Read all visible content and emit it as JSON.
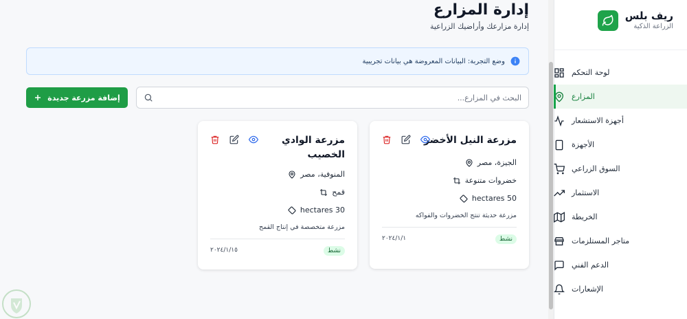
{
  "brand": {
    "title": "ريف بلس",
    "subtitle": "الزراعة الذكية"
  },
  "nav": [
    {
      "label": "لوحة التحكم",
      "icon": "dashboard-icon"
    },
    {
      "label": "المزارع",
      "icon": "map-pin-icon",
      "active": true
    },
    {
      "label": "أجهزة الاستشعار",
      "icon": "activity-icon"
    },
    {
      "label": "الأجهزة",
      "icon": "device-icon"
    },
    {
      "label": "السوق الزراعي",
      "icon": "cart-icon"
    },
    {
      "label": "الاستثمار",
      "icon": "trending-up-icon"
    },
    {
      "label": "الخريطة",
      "icon": "map-icon"
    },
    {
      "label": "متاجر المستلزمات",
      "icon": "store-icon"
    },
    {
      "label": "الدعم الفني",
      "icon": "chat-icon"
    },
    {
      "label": "الإشعارات",
      "icon": "bell-icon"
    }
  ],
  "header": {
    "title": "إدارة المزارع",
    "subtitle": "إدارة مزارعك وأراضيك الزراعية"
  },
  "alert": {
    "text": "وضع التجربة: البيانات المعروضة هي بيانات تجريبية",
    "color": "#3b82f6"
  },
  "search": {
    "placeholder": "البحث في المزارع..."
  },
  "add_button": {
    "label": "إضافة مزرعة جديدة"
  },
  "colors": {
    "primary": "#1f9d46",
    "danger": "#dc2626",
    "view": "#2563eb"
  },
  "farms": [
    {
      "name": "مزرعة النيل الأخضر",
      "location": "الجيزة، مصر",
      "crop": "خضروات متنوعة",
      "area": "hectares 50",
      "description": "مزرعة حديثة تنتج الخضروات والفواكه",
      "status": "نشط",
      "date": "٢٠٢٤/١/١"
    },
    {
      "name": "مزرعة الوادي الخصيب",
      "location": "المنوفية، مصر",
      "crop": "قمح",
      "area": "hectares 30",
      "description": "مزرعة متخصصة في إنتاج القمح",
      "status": "نشط",
      "date": "٢٠٢٤/١/١٥"
    }
  ]
}
